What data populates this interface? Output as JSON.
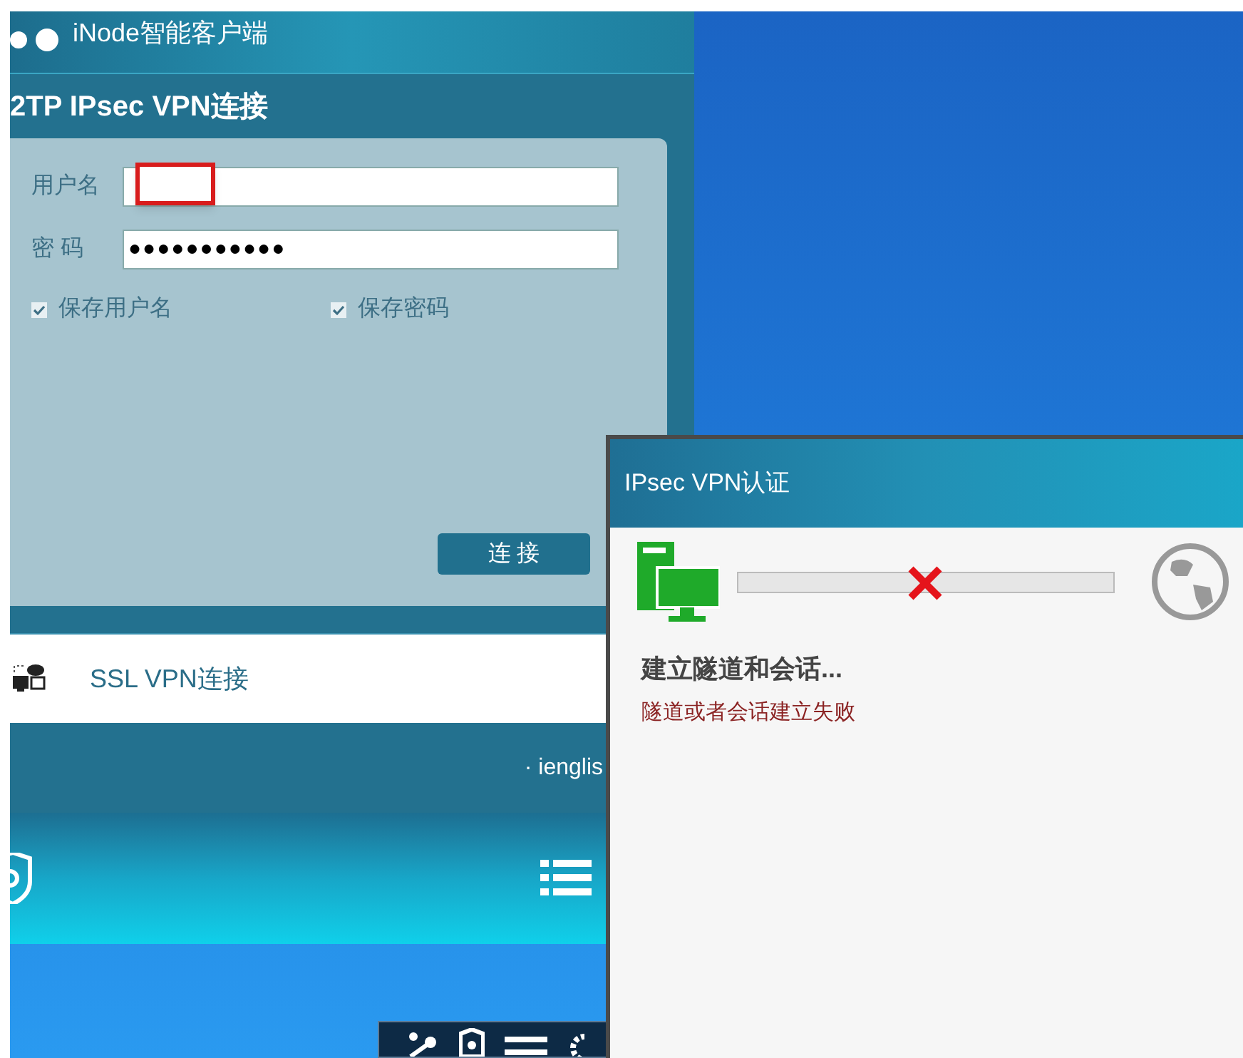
{
  "client_window": {
    "title": "iNode智能客户端",
    "l2tp": {
      "heading": "2TP IPsec VPN连接",
      "fields": [
        {
          "label": "用户名",
          "redacted": true
        },
        {
          "label": "密 码",
          "value": "●●●●●●●●●●●"
        }
      ],
      "checkboxes": [
        {
          "label": "保存用户名",
          "checked": true
        },
        {
          "label": "保存密码",
          "checked": true
        }
      ],
      "connect_button": "连 接"
    },
    "ssl": {
      "label": "SSL VPN连接"
    },
    "footer_link": "· ienglis"
  },
  "dialog": {
    "title": "IPsec VPN认证",
    "link_failed": true,
    "status": "建立隧道和会话...",
    "error": "隧道或者会话建立失败"
  }
}
